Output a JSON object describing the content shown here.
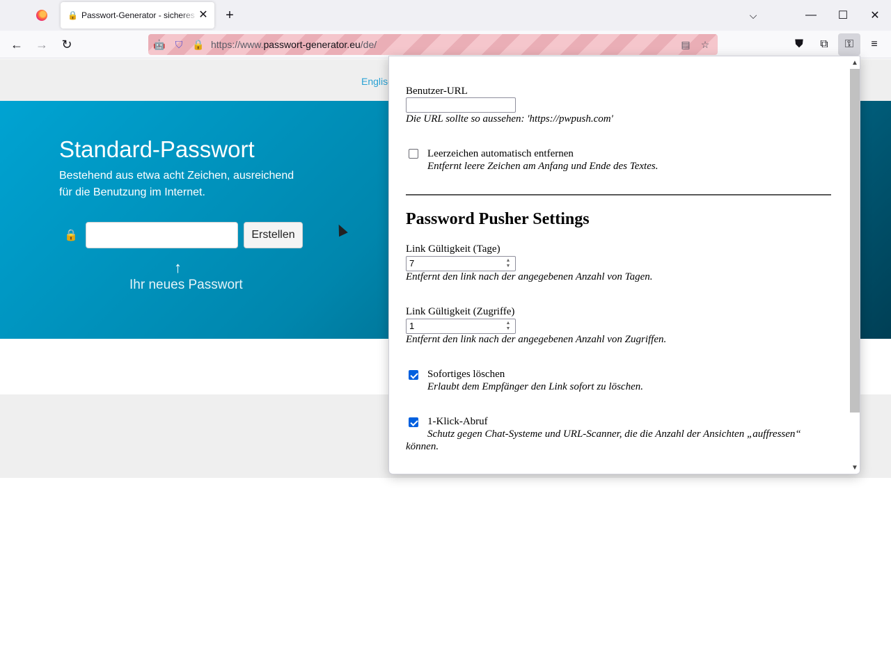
{
  "browser": {
    "tab_title": "Passwort-Generator - sicheres P",
    "url_prefix": "https://www.",
    "url_domain": "passwort-generator.eu",
    "url_path": "/de/"
  },
  "page": {
    "lang_link": "Englisc",
    "hero_title": "Standard-Passwort",
    "hero_desc": "Bestehend aus etwa acht Zeichen, ausreichend für die Benutzung im Internet.",
    "create_button": "Erstellen",
    "result_label": "Ihr neues Passwort"
  },
  "popup": {
    "user_url_label": "Benutzer-URL",
    "user_url_value": "",
    "user_url_help": "Die URL sollte so aussehen: 'https://pwpush.com'",
    "strip_label": "Leerzeichen automatisch entfernen",
    "strip_help": "Entfernt leere Zeichen am Anfang und Ende des Textes.",
    "strip_checked": false,
    "settings_heading": "Password Pusher Settings",
    "days_label": "Link Gültigkeit (Tage)",
    "days_value": "7",
    "days_help": "Entfernt den link nach der angegebenen Anzahl von Tagen.",
    "views_label": "Link Gültigkeit (Zugriffe)",
    "views_value": "1",
    "views_help": "Entfernt den link nach der angegebenen Anzahl von Zugriffen.",
    "delete_label": "Sofortiges löschen",
    "delete_help": "Erlaubt dem Empfänger den Link sofort zu löschen.",
    "delete_checked": true,
    "oneclick_label": "1-Klick-Abruf",
    "oneclick_help_1": "Schutz gegen Chat-Systeme und URL-Scanner, die die Anzahl der Ansichten „auffressen“",
    "oneclick_help_2": "können.",
    "oneclick_checked": true
  },
  "icons": {
    "firefox": "firefox-logo-icon",
    "tab_favicon": "lock-favicon-icon",
    "accent": "#0060df"
  }
}
